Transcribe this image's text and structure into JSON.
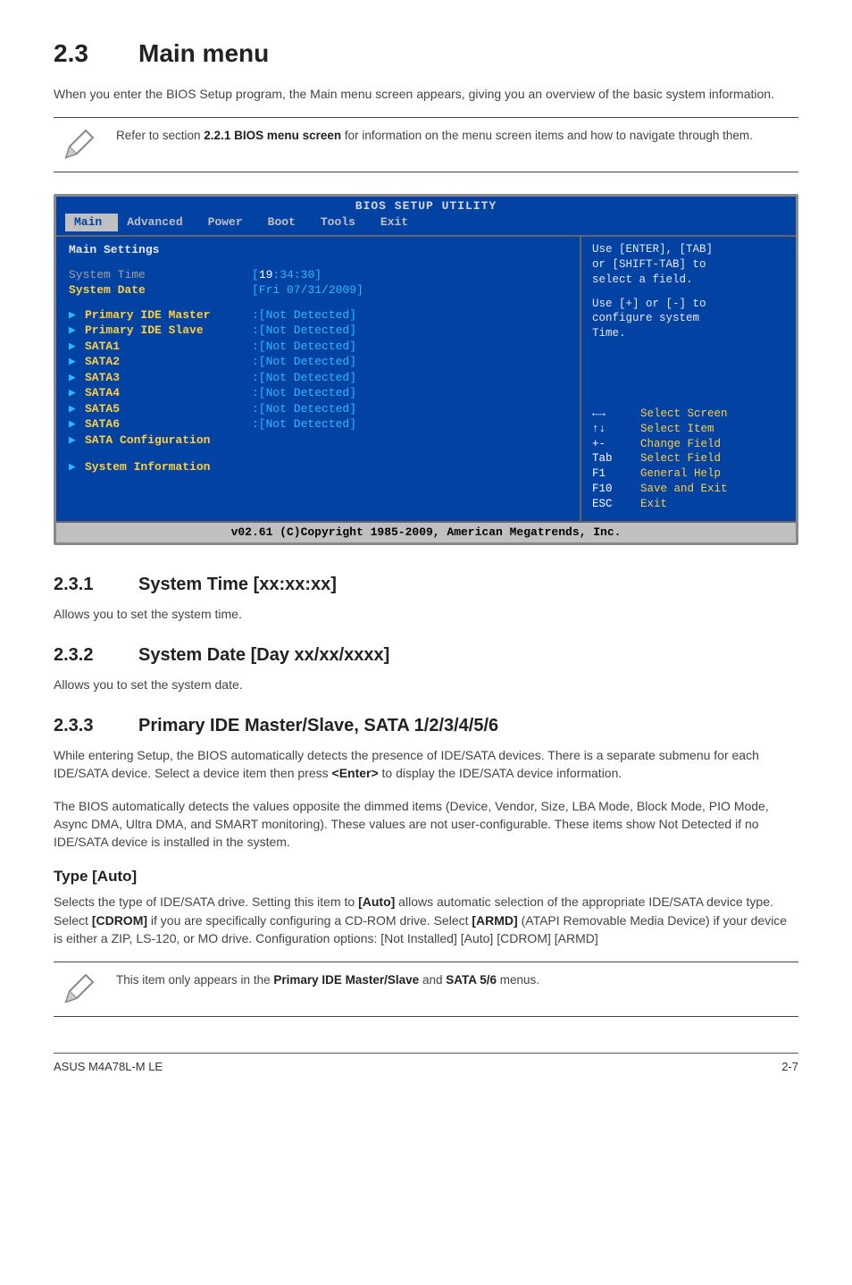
{
  "section": {
    "num": "2.3",
    "title": "Main menu"
  },
  "intro": "When you enter the BIOS Setup program, the Main menu screen appears, giving you an overview of the basic system information.",
  "note1_prefix": "Refer to section ",
  "note1_bold": "2.2.1 BIOS menu screen",
  "note1_suffix": " for information on the menu screen items and how to navigate through them.",
  "bios": {
    "title": "BIOS SETUP UTILITY",
    "menu": {
      "main": "Main",
      "advanced": "Advanced",
      "power": "Power",
      "boot": "Boot",
      "tools": "Tools",
      "exit": "Exit"
    },
    "heading": "Main Settings",
    "rows": {
      "system_time": {
        "label": "System Time",
        "hour": "19",
        "colon1": ":",
        "min": "34",
        "colon2": ":",
        "sec": "30",
        "open": "[",
        "close": "]"
      },
      "system_date": {
        "label": "System Date",
        "value": "[Fri 07/31/2009]"
      },
      "ide_master": {
        "label": "Primary IDE Master",
        "value": ":[Not Detected]"
      },
      "ide_slave": {
        "label": "Primary IDE Slave",
        "value": ":[Not Detected]"
      },
      "sata1": {
        "label": "SATA1",
        "value": ":[Not Detected]"
      },
      "sata2": {
        "label": "SATA2",
        "value": ":[Not Detected]"
      },
      "sata3": {
        "label": "SATA3",
        "value": ":[Not Detected]"
      },
      "sata4": {
        "label": "SATA4",
        "value": ":[Not Detected]"
      },
      "sata5": {
        "label": "SATA5",
        "value": ":[Not Detected]"
      },
      "sata6": {
        "label": "SATA6",
        "value": ":[Not Detected]"
      },
      "sata_cfg": {
        "label": "SATA Configuration"
      },
      "sysinfo": {
        "label": "System Information"
      }
    },
    "help": {
      "line1": "Use [ENTER], [TAB]",
      "line2": "or [SHIFT-TAB] to",
      "line3": "select a field.",
      "line4": "Use [+] or [-] to",
      "line5": "configure system",
      "line6": "Time.",
      "keys": [
        {
          "k": "←→",
          "d": "Select Screen"
        },
        {
          "k": "↑↓",
          "d": "Select Item"
        },
        {
          "k": "+-",
          "d": "Change Field"
        },
        {
          "k": "Tab",
          "d": "Select Field"
        },
        {
          "k": "F1",
          "d": "General Help"
        },
        {
          "k": "F10",
          "d": "Save and Exit"
        },
        {
          "k": "ESC",
          "d": "Exit"
        }
      ]
    },
    "footer": "v02.61 (C)Copyright 1985-2009, American Megatrends, Inc."
  },
  "sub1": {
    "num": "2.3.1",
    "title": "System Time [xx:xx:xx]",
    "body": "Allows you to set the system time."
  },
  "sub2": {
    "num": "2.3.2",
    "title": "System Date [Day xx/xx/xxxx]",
    "body": "Allows you to set the system date."
  },
  "sub3": {
    "num": "2.3.3",
    "title": "Primary IDE Master/Slave, SATA 1/2/3/4/5/6",
    "p1a": "While entering Setup, the BIOS automatically detects the presence of IDE/SATA devices. There is a separate submenu for each IDE/SATA device. Select a device item then press ",
    "p1b": "<Enter>",
    "p1c": " to display the IDE/SATA device information.",
    "p2": "The BIOS automatically detects the values opposite the dimmed items (Device, Vendor, Size, LBA Mode, Block Mode, PIO Mode, Async DMA, Ultra DMA, and SMART monitoring). These values are not user-configurable. These items show Not Detected if no IDE/SATA device is installed in the system."
  },
  "type": {
    "heading": "Type [Auto]",
    "t1": "Selects the type of IDE/SATA drive. Setting this item to ",
    "b1": "[Auto]",
    "t2": " allows automatic selection of the appropriate IDE/SATA device type. Select ",
    "b2": "[CDROM]",
    "t3": " if you are specifically configuring a CD-ROM drive. Select ",
    "b3": "[ARMD]",
    "t4": " (ATAPI Removable Media Device) if your device is either a ZIP, LS-120, or MO drive. Configuration options: [Not Installed] [Auto] [CDROM] [ARMD]"
  },
  "note2": {
    "t1": "This item only appears in the ",
    "b1": "Primary IDE Master/Slave",
    "t2": " and ",
    "b2": "SATA 5/6",
    "t3": " menus."
  },
  "footer": {
    "left": "ASUS M4A78L-M LE",
    "right": "2-7"
  }
}
